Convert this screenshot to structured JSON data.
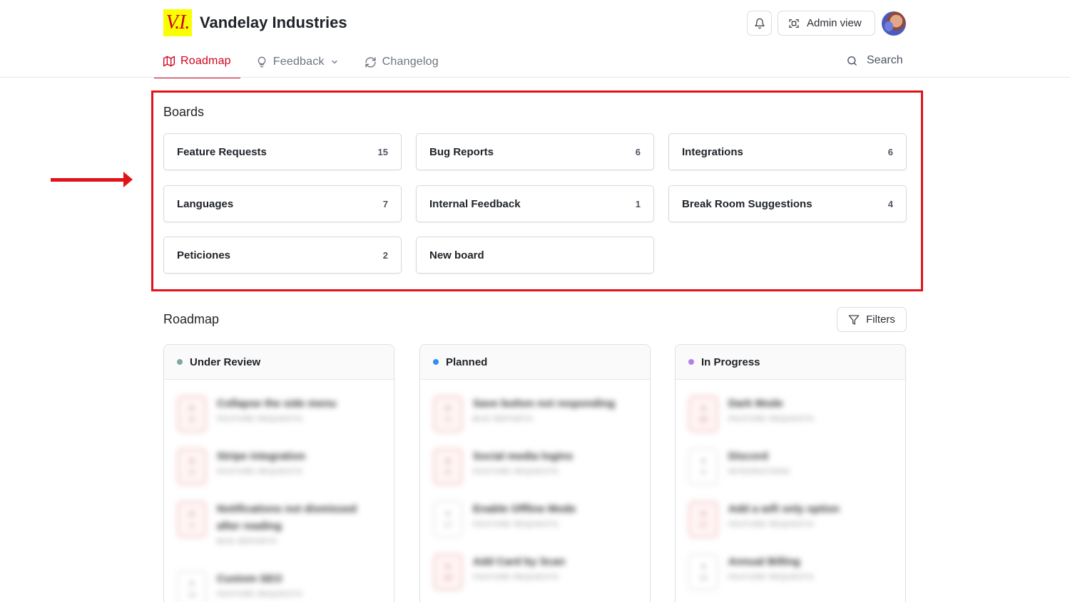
{
  "header": {
    "logo_text": "V.I.",
    "brand": "Vandelay Industries",
    "admin_label": "Admin view"
  },
  "nav": {
    "roadmap": "Roadmap",
    "feedback": "Feedback",
    "changelog": "Changelog",
    "search": "Search"
  },
  "boards": {
    "title": "Boards",
    "items": [
      {
        "name": "Feature Requests",
        "count": "15"
      },
      {
        "name": "Bug Reports",
        "count": "6"
      },
      {
        "name": "Integrations",
        "count": "6"
      },
      {
        "name": "Languages",
        "count": "7"
      },
      {
        "name": "Internal Feedback",
        "count": "1"
      },
      {
        "name": "Break Room Suggestions",
        "count": "4"
      },
      {
        "name": "Peticiones",
        "count": "2"
      },
      {
        "name": "New board",
        "count": ""
      }
    ]
  },
  "roadmap": {
    "title": "Roadmap",
    "filters_label": "Filters",
    "columns": [
      {
        "title": "Under Review",
        "dot_color": "#7fa8a0",
        "posts": [
          {
            "title": "Collapse the side menu",
            "board": "FEATURE REQUESTS",
            "votes": "8"
          },
          {
            "title": "Stripe integration",
            "board": "FEATURE REQUESTS",
            "votes": "3"
          },
          {
            "title": "Notifications not dismissed after reading",
            "board": "BUG REPORTS",
            "votes": "1"
          },
          {
            "title": "Custom SEO",
            "board": "FEATURE REQUESTS",
            "votes": "12"
          }
        ]
      },
      {
        "title": "Planned",
        "dot_color": "#2f8ff0",
        "posts": [
          {
            "title": "Save button not responding",
            "board": "BUG REPORTS",
            "votes": "2"
          },
          {
            "title": "Social media logins",
            "board": "FEATURE REQUESTS",
            "votes": "8"
          },
          {
            "title": "Enable Offline Mode",
            "board": "FEATURE REQUESTS",
            "votes": "17"
          },
          {
            "title": "Add Card by Scan",
            "board": "FEATURE REQUESTS",
            "votes": "20"
          }
        ]
      },
      {
        "title": "In Progress",
        "dot_color": "#b57ee8",
        "posts": [
          {
            "title": "Dark Mode",
            "board": "FEATURE REQUESTS",
            "votes": "30"
          },
          {
            "title": "Discord",
            "board": "INTEGRATIONS",
            "votes": "9"
          },
          {
            "title": "Add a wifi only option",
            "board": "FEATURE REQUESTS",
            "votes": "17"
          },
          {
            "title": "Annual Billing",
            "board": "FEATURE REQUESTS",
            "votes": "15"
          }
        ]
      }
    ]
  },
  "colors": {
    "accent": "#d0021b",
    "annotation": "#e0131b",
    "logo_bg": "#f7ff00"
  }
}
